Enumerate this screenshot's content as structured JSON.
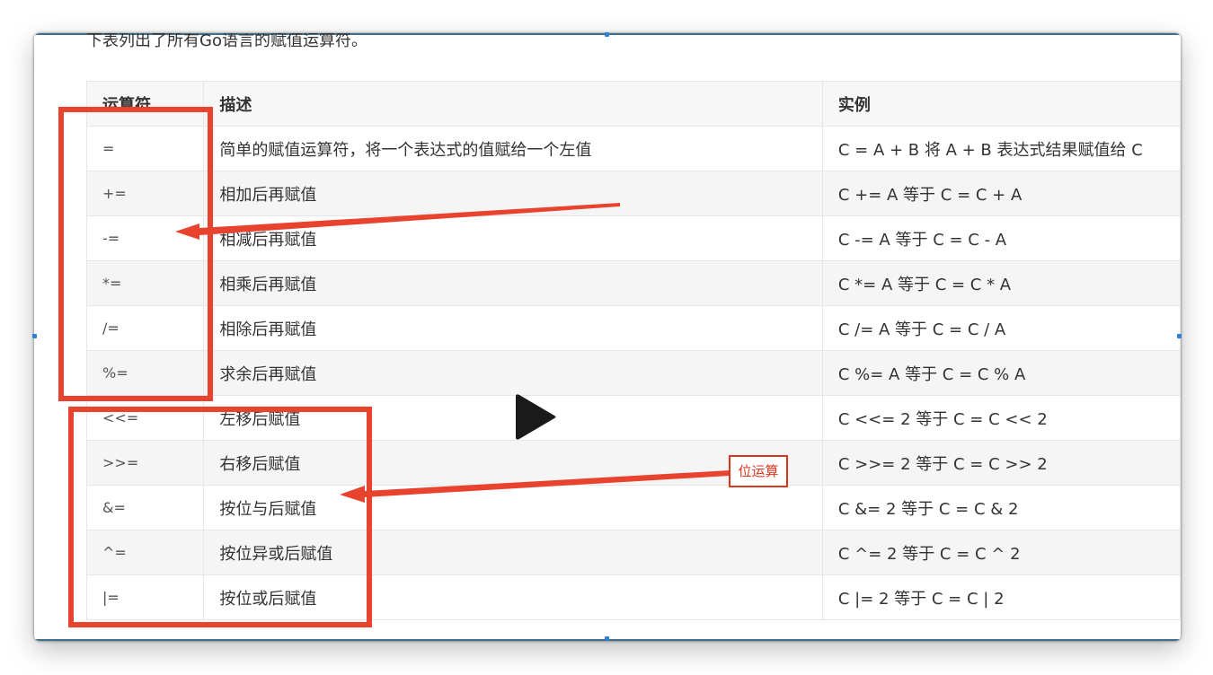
{
  "intro_text": "下表列出了所有Go语言的赋值运算符。",
  "table": {
    "headers": [
      "运算符",
      "描述",
      "实例"
    ],
    "rows": [
      {
        "op": "=",
        "desc": "简单的赋值运算符，将一个表达式的值赋给一个左值",
        "example": "C = A + B 将 A + B 表达式结果赋值给 C"
      },
      {
        "op": "+=",
        "desc": "相加后再赋值",
        "example": "C += A 等于 C = C + A"
      },
      {
        "op": "-=",
        "desc": "相减后再赋值",
        "example": "C -= A 等于 C = C - A"
      },
      {
        "op": "*=",
        "desc": "相乘后再赋值",
        "example": "C *= A 等于 C = C * A"
      },
      {
        "op": "/=",
        "desc": "相除后再赋值",
        "example": "C /= A 等于 C = C / A"
      },
      {
        "op": "%=",
        "desc": "求余后再赋值",
        "example": "C %= A 等于 C = C % A"
      },
      {
        "op": "<<=",
        "desc": "左移后赋值",
        "example": "C <<= 2 等于 C = C << 2"
      },
      {
        "op": ">>=",
        "desc": "右移后赋值",
        "example": "C >>= 2 等于 C = C >> 2"
      },
      {
        "op": "&=",
        "desc": "按位与后赋值",
        "example": "C &= 2 等于 C = C & 2"
      },
      {
        "op": "^=",
        "desc": "按位异或后赋值",
        "example": "C ^= 2 等于 C = C ^ 2"
      },
      {
        "op": "|=",
        "desc": "按位或后赋值",
        "example": "C |= 2 等于 C = C | 2"
      }
    ]
  },
  "annotation": {
    "bit_label": "位运算",
    "color": "#e8432f"
  },
  "icons": {
    "play": "play-icon"
  }
}
